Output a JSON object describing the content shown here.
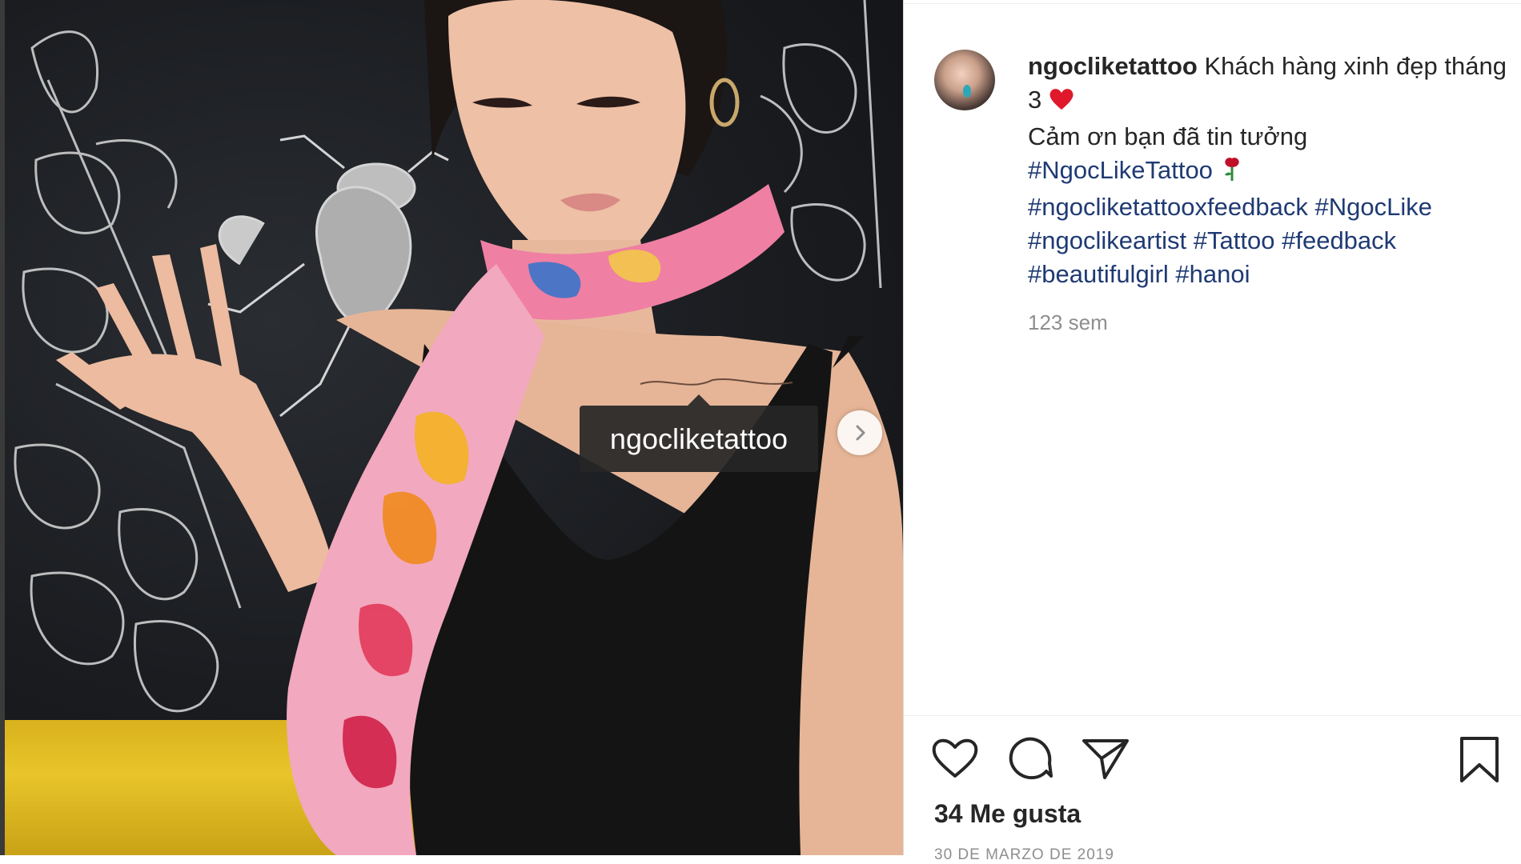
{
  "post": {
    "photo_tag_username": "ngocliketattoo",
    "next_label": "Next",
    "author_username": "ngocliketattoo",
    "caption_line1": "Khách hàng xinh đẹp tháng 3",
    "caption_line2": "Cảm ơn bạn đã tin tưởng",
    "hashtags": [
      "#NgocLikeTattoo",
      "#ngocliketattooxfeedback",
      "#NgocLike",
      "#ngoclikeartist",
      "#Tattoo",
      "#feedback",
      "#beautifulgirl",
      "#hanoi"
    ],
    "time_ago": "123 sem",
    "likes": "34 Me gusta",
    "date": "30 DE MARZO DE 2019"
  },
  "actions": {
    "like_icon": "heart-icon",
    "comment_icon": "comment-icon",
    "share_icon": "paper-plane-icon",
    "save_icon": "bookmark-icon"
  },
  "colors": {
    "hashtag": "#1f3a73",
    "text": "#262626",
    "muted": "#8e8e8e",
    "heart_emoji": "#e0182c",
    "rose_emoji": "#c0112a"
  }
}
